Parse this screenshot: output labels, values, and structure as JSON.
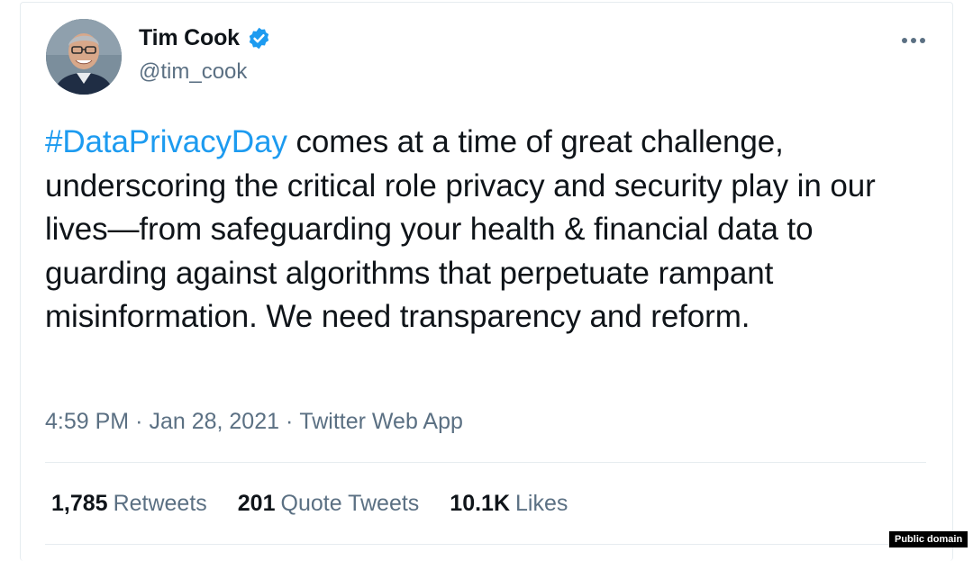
{
  "author": {
    "name": "Tim Cook",
    "handle": "@tim_cook",
    "verified_icon": "verified-badge-icon",
    "avatar": "profile-photo"
  },
  "tweet": {
    "hashtag": "#DataPrivacyDay",
    "body": " comes at a time of great challenge, underscoring the critical role privacy and security play in our lives—from safeguarding your health & financial data to guarding against algorithms that perpetuate rampant misinformation. We need transparency and reform."
  },
  "meta": {
    "time": "4:59 PM",
    "separator": "·",
    "date": "Jan 28, 2021",
    "source": "Twitter Web App"
  },
  "stats": {
    "retweets_count": "1,785",
    "retweets_label": "Retweets",
    "quotes_count": "201",
    "quotes_label": "Quote Tweets",
    "likes_count": "10.1K",
    "likes_label": "Likes"
  },
  "credit": "Public domain",
  "colors": {
    "link": "#1d9bf0",
    "secondary_text": "#5b7083",
    "primary_text": "#0f1419"
  }
}
